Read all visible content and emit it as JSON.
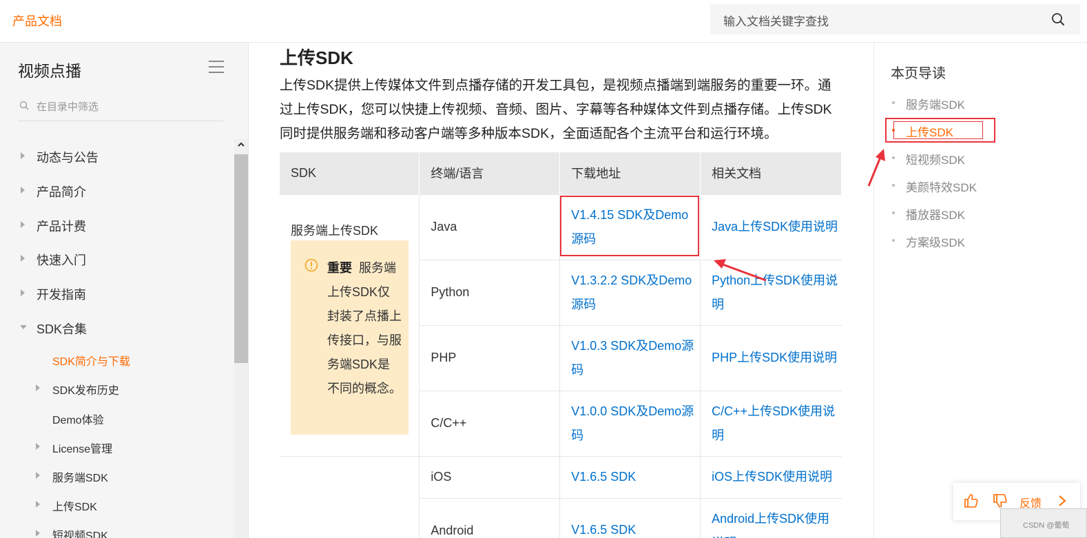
{
  "header": {
    "brand": "产品文档",
    "search_placeholder": "输入文档关键字查找"
  },
  "sidebar": {
    "title": "视频点播",
    "filter_placeholder": "在目录中筛选",
    "items": [
      {
        "label": "动态与公告"
      },
      {
        "label": "产品简介"
      },
      {
        "label": "产品计费"
      },
      {
        "label": "快速入门"
      },
      {
        "label": "开发指南"
      },
      {
        "label": "SDK合集"
      }
    ],
    "sub_items": [
      {
        "label": "SDK简介与下载",
        "active": true
      },
      {
        "label": "SDK发布历史"
      },
      {
        "label": "Demo体验"
      },
      {
        "label": "License管理"
      },
      {
        "label": "服务端SDK"
      },
      {
        "label": "上传SDK"
      },
      {
        "label": "短视频SDK"
      }
    ]
  },
  "main": {
    "heading": "上传SDK",
    "intro": "上传SDK提供上传媒体文件到点播存储的开发工具包，是视频点播端到端服务的重要一环。通过上传SDK，您可以快捷上传视频、音频、图片、字幕等各种媒体文件到点播存储。上传SDK同时提供服务端和移动客户端等多种版本SDK，全面适配各个主流平台和运行环境。",
    "table": {
      "headers": [
        "SDK",
        "终端/语言",
        "下载地址",
        "相关文档"
      ],
      "group1_label": "服务端上传SDK",
      "note_strong": "重要",
      "note_text": "服务端上传SDK仅封装了点播上传接口，与服务端SDK是不同的概念。",
      "rows": [
        {
          "lang": "Java",
          "download": "V1.4.15 SDK及Demo源码",
          "doc": "Java上传SDK使用说明"
        },
        {
          "lang": "Python",
          "download": "V1.3.2.2 SDK及Demo源码",
          "doc": "Python上传SDK使用说明"
        },
        {
          "lang": "PHP",
          "download": "V1.0.3 SDK及Demo源码",
          "doc": "PHP上传SDK使用说明"
        },
        {
          "lang": "C/C++",
          "download": "V1.0.0 SDK及Demo源码",
          "doc": "C/C++上传SDK使用说明"
        },
        {
          "lang": "iOS",
          "download": "V1.6.5 SDK",
          "doc": "iOS上传SDK使用说明"
        },
        {
          "lang": "Android",
          "download": "V1.6.5 SDK",
          "doc": "Android上传SDK使用说明"
        }
      ]
    }
  },
  "toc": {
    "title": "本页导读",
    "items": [
      {
        "label": "服务端SDK"
      },
      {
        "label": "上传SDK",
        "active": true
      },
      {
        "label": "短视频SDK"
      },
      {
        "label": "美颜特效SDK"
      },
      {
        "label": "播放器SDK"
      },
      {
        "label": "方案级SDK"
      }
    ]
  },
  "feedback": {
    "label": "反馈"
  },
  "watermark": "CSDN @葡萄",
  "colors": {
    "accent": "#ff6a00",
    "link": "#0070cc",
    "annotation": "#e8333b",
    "note_bg": "#fdebc8"
  }
}
